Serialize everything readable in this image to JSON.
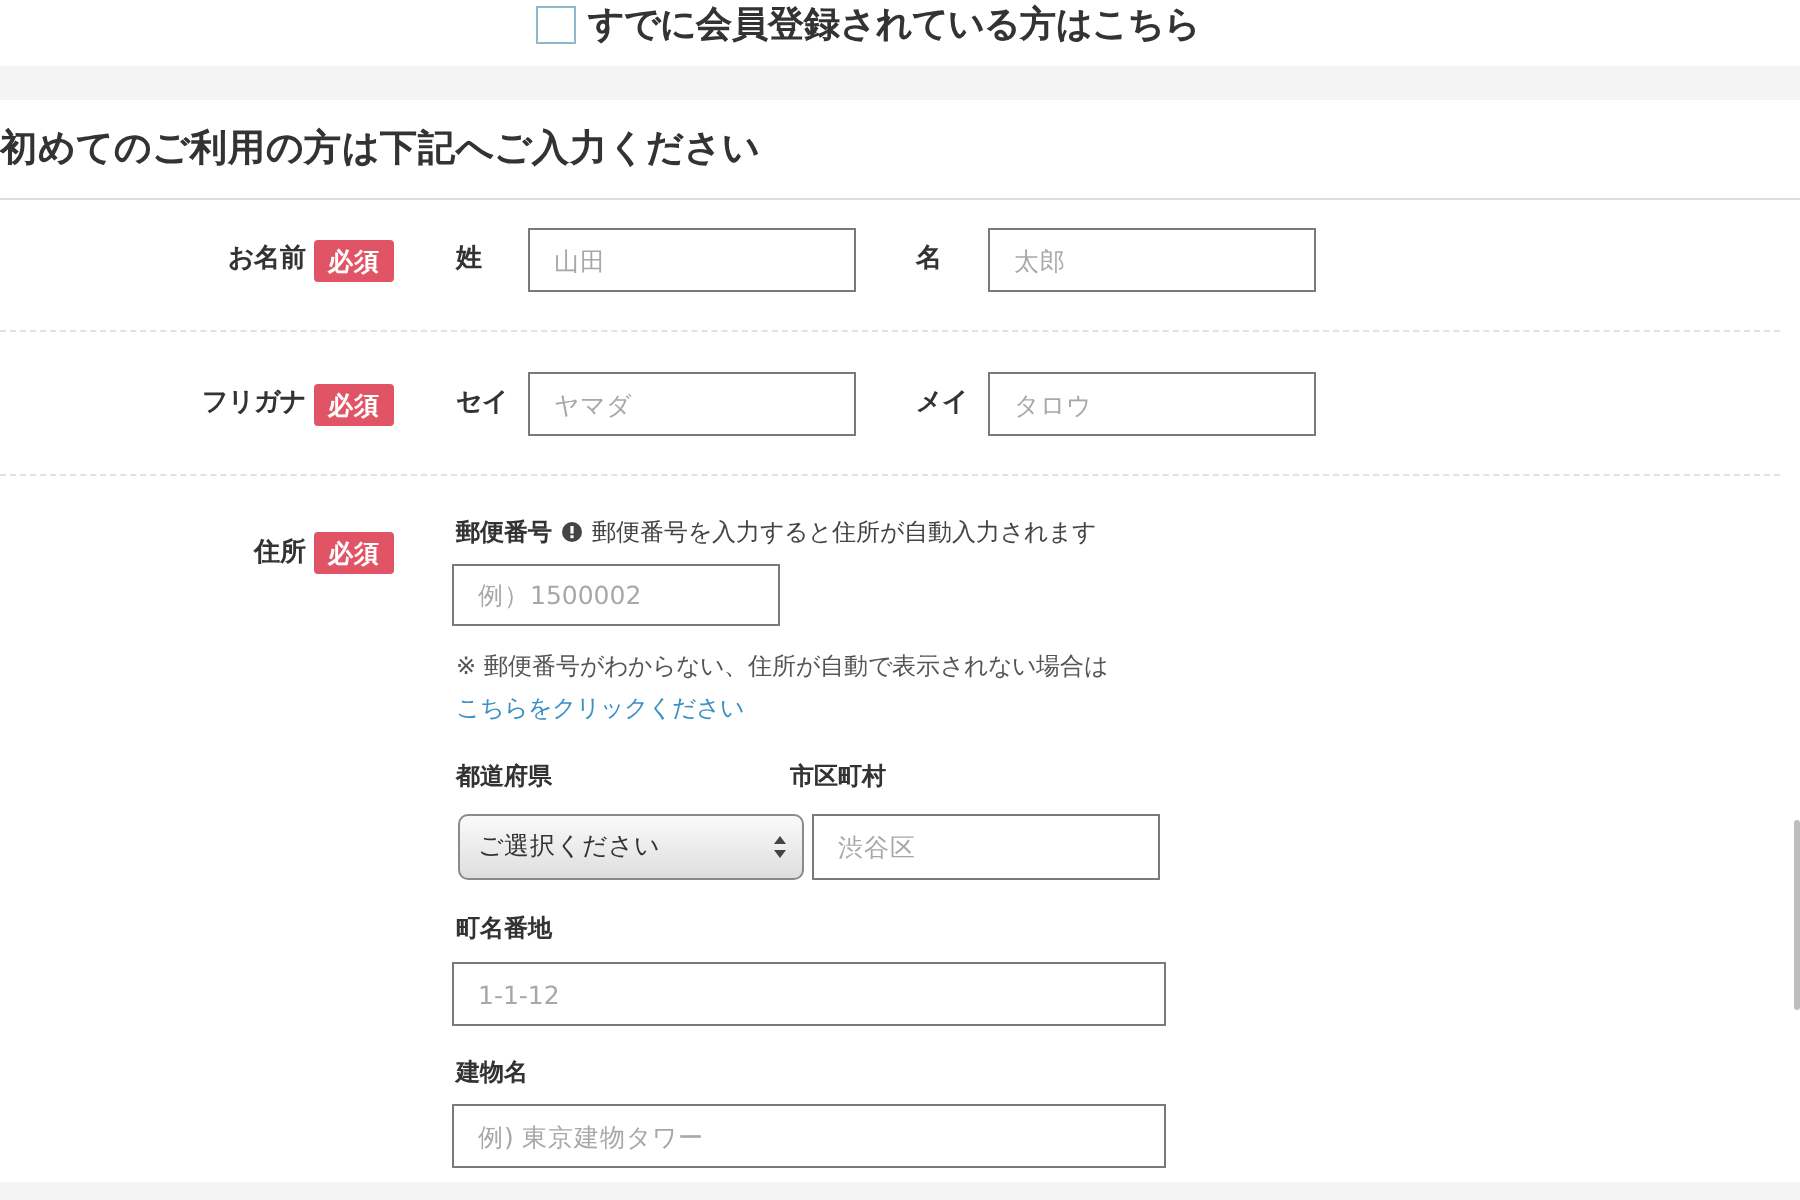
{
  "login_link": {
    "checked": false,
    "label": "すでに会員登録されている方はこちら"
  },
  "form": {
    "heading": "初めてのご利用の方は下記へご入力ください",
    "rows": [
      {
        "kind": "name_pair",
        "label": "お名前",
        "badge": "必須",
        "fields": [
          {
            "label": "姓",
            "placeholder": "山田"
          },
          {
            "label": "名",
            "placeholder": "太郎"
          }
        ]
      },
      {
        "kind": "name_pair",
        "label": "フリガナ",
        "badge": "必須",
        "fields": [
          {
            "label": "セイ",
            "placeholder": "ヤマダ"
          },
          {
            "label": "メイ",
            "placeholder": "タロウ"
          }
        ]
      },
      {
        "kind": "address",
        "label": "住所",
        "badge": "必須",
        "postal": {
          "label": "郵便番号",
          "hint": "郵便番号を入力すると住所が自動入力されます",
          "placeholder": "例）1500002",
          "note": "※ 郵便番号がわからない、住所が自動で表示されない場合は",
          "note_link": "こちらをクリックください"
        },
        "prefecture": {
          "label": "都道府県",
          "value": "ご選択ください"
        },
        "city": {
          "label": "市区町村",
          "placeholder": "渋谷区"
        },
        "street": {
          "label": "町名番地",
          "placeholder": "1-1-12"
        },
        "building": {
          "label": "建物名",
          "placeholder": "例) 東京建物タワー"
        }
      }
    ]
  }
}
